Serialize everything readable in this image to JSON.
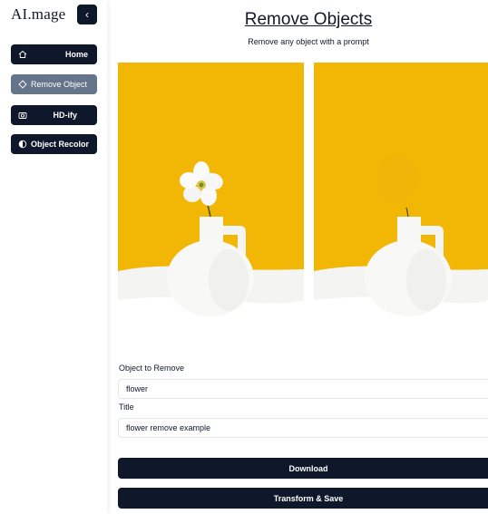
{
  "app": {
    "logo": "AI.mage",
    "collapse_icon": "chevron-left-icon"
  },
  "sidebar": {
    "items": [
      {
        "label": "Home",
        "icon": "home-icon",
        "active": false
      },
      {
        "label": "Remove Object",
        "icon": "eraser-icon",
        "active": true
      },
      {
        "label": "HD-ify",
        "icon": "camera-icon",
        "active": false
      },
      {
        "label": "Object Recolor",
        "icon": "contrast-icon",
        "active": false
      }
    ]
  },
  "main": {
    "title": "Remove Objects",
    "subtitle": "Remove any object with a prompt",
    "images": {
      "original": "vase-with-flower-image",
      "result": "vase-without-flower-image"
    },
    "form": {
      "object_label": "Object to Remove",
      "object_value": "flower",
      "title_label": "Title",
      "title_value": "flower remove example"
    },
    "buttons": {
      "download": "Download",
      "transform": "Transform & Save"
    }
  },
  "colors": {
    "primary": "#0f172a",
    "active": "#64748b",
    "image_background": "#f2b705"
  }
}
